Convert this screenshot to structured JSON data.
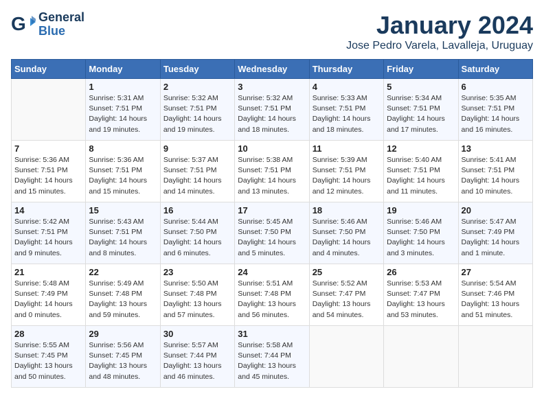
{
  "logo": {
    "line1": "General",
    "line2": "Blue"
  },
  "title": "January 2024",
  "location": "Jose Pedro Varela, Lavalleja, Uruguay",
  "days_of_week": [
    "Sunday",
    "Monday",
    "Tuesday",
    "Wednesday",
    "Thursday",
    "Friday",
    "Saturday"
  ],
  "weeks": [
    [
      {
        "day": "",
        "data": ""
      },
      {
        "day": "1",
        "data": "Sunrise: 5:31 AM\nSunset: 7:51 PM\nDaylight: 14 hours\nand 19 minutes."
      },
      {
        "day": "2",
        "data": "Sunrise: 5:32 AM\nSunset: 7:51 PM\nDaylight: 14 hours\nand 19 minutes."
      },
      {
        "day": "3",
        "data": "Sunrise: 5:32 AM\nSunset: 7:51 PM\nDaylight: 14 hours\nand 18 minutes."
      },
      {
        "day": "4",
        "data": "Sunrise: 5:33 AM\nSunset: 7:51 PM\nDaylight: 14 hours\nand 18 minutes."
      },
      {
        "day": "5",
        "data": "Sunrise: 5:34 AM\nSunset: 7:51 PM\nDaylight: 14 hours\nand 17 minutes."
      },
      {
        "day": "6",
        "data": "Sunrise: 5:35 AM\nSunset: 7:51 PM\nDaylight: 14 hours\nand 16 minutes."
      }
    ],
    [
      {
        "day": "7",
        "data": "Sunrise: 5:36 AM\nSunset: 7:51 PM\nDaylight: 14 hours\nand 15 minutes."
      },
      {
        "day": "8",
        "data": "Sunrise: 5:36 AM\nSunset: 7:51 PM\nDaylight: 14 hours\nand 15 minutes."
      },
      {
        "day": "9",
        "data": "Sunrise: 5:37 AM\nSunset: 7:51 PM\nDaylight: 14 hours\nand 14 minutes."
      },
      {
        "day": "10",
        "data": "Sunrise: 5:38 AM\nSunset: 7:51 PM\nDaylight: 14 hours\nand 13 minutes."
      },
      {
        "day": "11",
        "data": "Sunrise: 5:39 AM\nSunset: 7:51 PM\nDaylight: 14 hours\nand 12 minutes."
      },
      {
        "day": "12",
        "data": "Sunrise: 5:40 AM\nSunset: 7:51 PM\nDaylight: 14 hours\nand 11 minutes."
      },
      {
        "day": "13",
        "data": "Sunrise: 5:41 AM\nSunset: 7:51 PM\nDaylight: 14 hours\nand 10 minutes."
      }
    ],
    [
      {
        "day": "14",
        "data": "Sunrise: 5:42 AM\nSunset: 7:51 PM\nDaylight: 14 hours\nand 9 minutes."
      },
      {
        "day": "15",
        "data": "Sunrise: 5:43 AM\nSunset: 7:51 PM\nDaylight: 14 hours\nand 8 minutes."
      },
      {
        "day": "16",
        "data": "Sunrise: 5:44 AM\nSunset: 7:50 PM\nDaylight: 14 hours\nand 6 minutes."
      },
      {
        "day": "17",
        "data": "Sunrise: 5:45 AM\nSunset: 7:50 PM\nDaylight: 14 hours\nand 5 minutes."
      },
      {
        "day": "18",
        "data": "Sunrise: 5:46 AM\nSunset: 7:50 PM\nDaylight: 14 hours\nand 4 minutes."
      },
      {
        "day": "19",
        "data": "Sunrise: 5:46 AM\nSunset: 7:50 PM\nDaylight: 14 hours\nand 3 minutes."
      },
      {
        "day": "20",
        "data": "Sunrise: 5:47 AM\nSunset: 7:49 PM\nDaylight: 14 hours\nand 1 minute."
      }
    ],
    [
      {
        "day": "21",
        "data": "Sunrise: 5:48 AM\nSunset: 7:49 PM\nDaylight: 14 hours\nand 0 minutes."
      },
      {
        "day": "22",
        "data": "Sunrise: 5:49 AM\nSunset: 7:48 PM\nDaylight: 13 hours\nand 59 minutes."
      },
      {
        "day": "23",
        "data": "Sunrise: 5:50 AM\nSunset: 7:48 PM\nDaylight: 13 hours\nand 57 minutes."
      },
      {
        "day": "24",
        "data": "Sunrise: 5:51 AM\nSunset: 7:48 PM\nDaylight: 13 hours\nand 56 minutes."
      },
      {
        "day": "25",
        "data": "Sunrise: 5:52 AM\nSunset: 7:47 PM\nDaylight: 13 hours\nand 54 minutes."
      },
      {
        "day": "26",
        "data": "Sunrise: 5:53 AM\nSunset: 7:47 PM\nDaylight: 13 hours\nand 53 minutes."
      },
      {
        "day": "27",
        "data": "Sunrise: 5:54 AM\nSunset: 7:46 PM\nDaylight: 13 hours\nand 51 minutes."
      }
    ],
    [
      {
        "day": "28",
        "data": "Sunrise: 5:55 AM\nSunset: 7:45 PM\nDaylight: 13 hours\nand 50 minutes."
      },
      {
        "day": "29",
        "data": "Sunrise: 5:56 AM\nSunset: 7:45 PM\nDaylight: 13 hours\nand 48 minutes."
      },
      {
        "day": "30",
        "data": "Sunrise: 5:57 AM\nSunset: 7:44 PM\nDaylight: 13 hours\nand 46 minutes."
      },
      {
        "day": "31",
        "data": "Sunrise: 5:58 AM\nSunset: 7:44 PM\nDaylight: 13 hours\nand 45 minutes."
      },
      {
        "day": "",
        "data": ""
      },
      {
        "day": "",
        "data": ""
      },
      {
        "day": "",
        "data": ""
      }
    ]
  ]
}
